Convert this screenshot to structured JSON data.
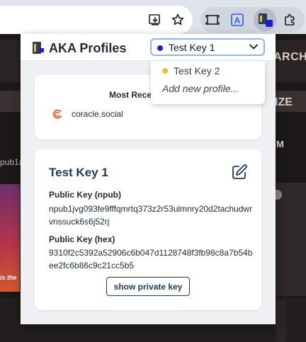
{
  "browser": {
    "toolbar_icons": [
      "install-icon",
      "star-icon",
      "screen-capture-icon",
      "translate-icon",
      "aka-profiles-extension-icon",
      "extensions-puzzle-icon"
    ],
    "translate_glyph": "A"
  },
  "background_page": {
    "search_text": "ARCH",
    "ize_text": "IZE",
    "m_text": "M",
    "pub_text": "pub1a",
    "is_the_text": "is the"
  },
  "popup": {
    "app_title": "AKA Profiles",
    "profile_select": {
      "selected": "Test Key 1",
      "selected_color": "#1e1bd6",
      "options": [
        {
          "label": "Test Key 2",
          "color": "#f5b83d"
        }
      ],
      "add_label": "Add new profile..."
    },
    "recent": {
      "heading": "Most Rece",
      "site": "coracle.social"
    },
    "profile": {
      "name": "Test Key 1",
      "npub_label": "Public Key (npub)",
      "npub_value": "npub1jvg093fe9fffqmrtq373z2r53ulmnry20d2tachudwrvnssuck6s6j52rj",
      "hex_label": "Public Key (hex)",
      "hex_value": "9310f2c5392a52906c6b047d1128748f3fb98c8a7b54bee2fc6b86c9c21cc5b5",
      "show_private_label": "show private key"
    }
  }
}
